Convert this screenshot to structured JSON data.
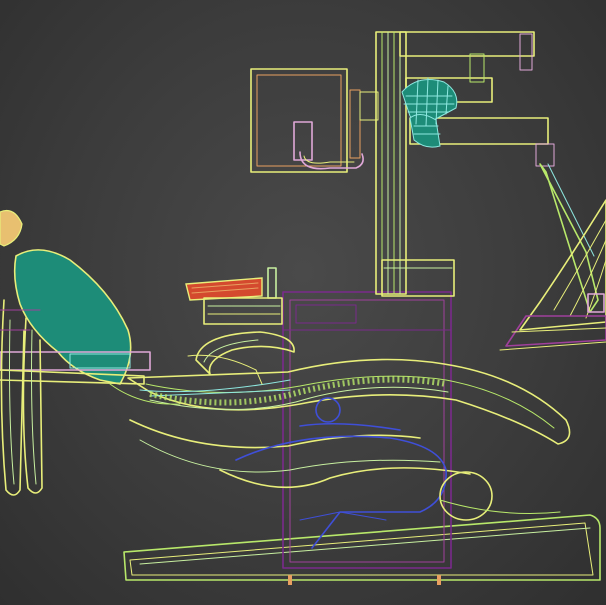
{
  "viewport": {
    "view_type": "wireframe",
    "object": "dental-unit-model",
    "background": "#3c3c3c"
  },
  "colors": {
    "yellow": "#e8ee7a",
    "lime": "#b8e86a",
    "teal": "#1d8c78",
    "purple": "#7a2a8c",
    "magenta": "#a0409c",
    "blue": "#3f4fd8",
    "orange": "#e8a060",
    "red": "#d44a2e",
    "pink": "#e0a8d8",
    "cyan": "#8ee8e0",
    "light_green": "#c8f0a0"
  },
  "parts": [
    {
      "name": "lamp-head",
      "icon": "lamp-icon"
    },
    {
      "name": "monitor-frame",
      "icon": "monitor-icon"
    },
    {
      "name": "instrument-tray",
      "icon": "tray-icon"
    },
    {
      "name": "headrest",
      "icon": "headrest-icon"
    },
    {
      "name": "chair-base",
      "icon": "base-icon"
    },
    {
      "name": "backrest-seat",
      "icon": "seat-icon"
    },
    {
      "name": "delivery-arm",
      "icon": "arm-icon"
    },
    {
      "name": "spittoon-bowl",
      "icon": "bowl-icon"
    }
  ]
}
